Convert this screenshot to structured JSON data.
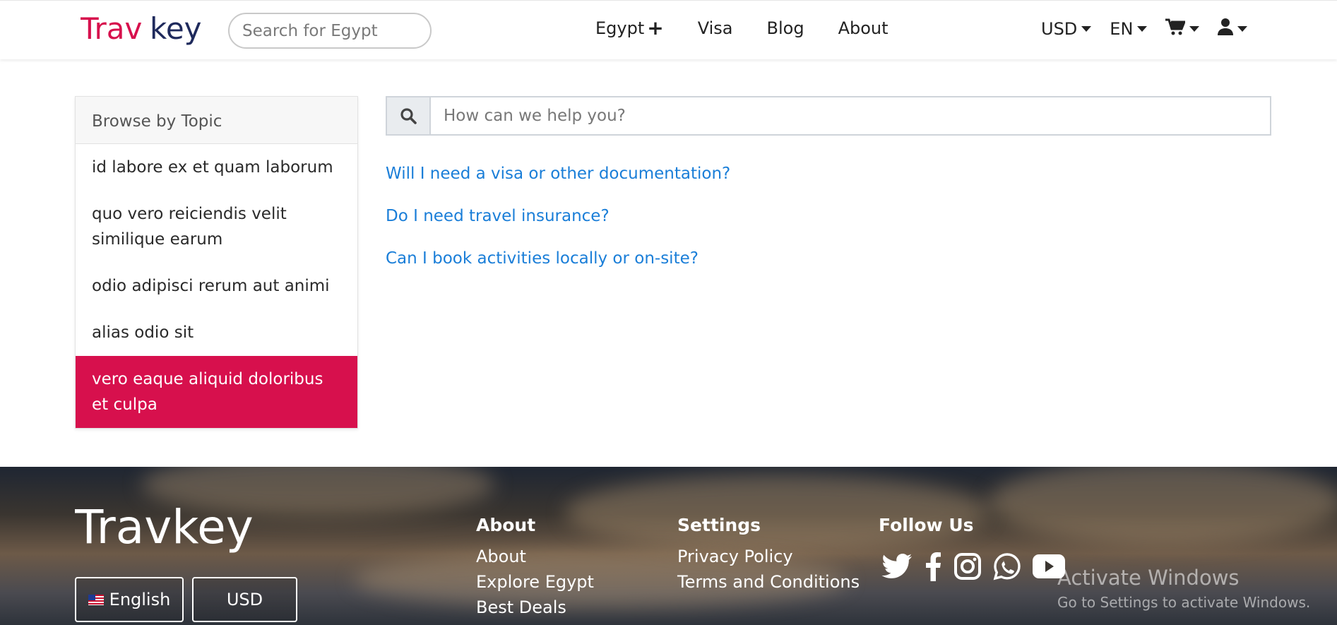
{
  "brand": {
    "name": "Travkey",
    "primary_color": "#d7104d",
    "secondary_color": "#1f2a5c"
  },
  "nav": {
    "search_placeholder": "Search for Egypt",
    "links": [
      "Egypt",
      "Visa",
      "Blog",
      "About"
    ],
    "egypt_expand_icon": "plus-icon",
    "currency": "USD",
    "language": "EN",
    "cart_icon": "cart-icon",
    "user_icon": "user-icon"
  },
  "sidebar": {
    "header": "Browse by Topic",
    "topics": [
      "id labore ex et quam laborum",
      "quo vero reiciendis velit similique earum",
      "odio adipisci rerum aut animi",
      "alias odio sit",
      "vero eaque aliquid doloribus et culpa"
    ],
    "active_index": 4
  },
  "help": {
    "search_placeholder": "How can we help you?",
    "search_icon": "search-icon",
    "questions": [
      "Will I need a visa or other documentation?",
      "Do I need travel insurance?",
      "Can I book activities locally or on-site?"
    ],
    "link_color": "#1a7ed8"
  },
  "footer": {
    "logo_text": "Travkey",
    "language_button": "English",
    "currency_button": "USD",
    "about_heading": "About",
    "about_links": [
      "About",
      "Explore Egypt",
      "Best Deals"
    ],
    "settings_heading": "Settings",
    "settings_links": [
      "Privacy Policy",
      "Terms and Conditions"
    ],
    "follow_heading": "Follow Us",
    "social_icons": [
      "twitter-icon",
      "facebook-icon",
      "instagram-icon",
      "whatsapp-icon",
      "youtube-icon"
    ]
  },
  "watermark": {
    "title": "Activate Windows",
    "subtitle": "Go to Settings to activate Windows."
  }
}
